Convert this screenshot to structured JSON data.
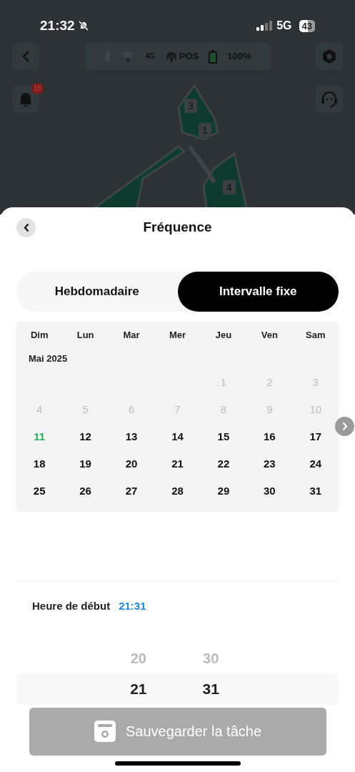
{
  "status_bar": {
    "time": "21:32",
    "network": "5G",
    "battery": "43"
  },
  "toolbar": {
    "network_label": "4G",
    "pos_label": "POS",
    "battery_level": "100%",
    "notification_count": "15"
  },
  "map": {
    "markers": [
      "3",
      "1",
      "4"
    ]
  },
  "sheet": {
    "title": "Fréquence",
    "tabs": [
      {
        "label": "Hebdomadaire",
        "selected": false
      },
      {
        "label": "Intervalle fixe",
        "selected": true
      }
    ],
    "calendar": {
      "weekdays": [
        "Dim",
        "Lun",
        "Mar",
        "Mer",
        "Jeu",
        "Ven",
        "Sam"
      ],
      "month": "Mai 2025",
      "weeks": [
        [
          {
            "kind": "blank"
          },
          {
            "kind": "blank"
          },
          {
            "kind": "blank"
          },
          {
            "kind": "blank"
          },
          {
            "kind": "past",
            "label": "1"
          },
          {
            "kind": "past",
            "label": "2"
          },
          {
            "kind": "past",
            "label": "3"
          }
        ],
        [
          {
            "kind": "past",
            "label": "4"
          },
          {
            "kind": "past",
            "label": "5"
          },
          {
            "kind": "past",
            "label": "6"
          },
          {
            "kind": "past",
            "label": "7"
          },
          {
            "kind": "past",
            "label": "8"
          },
          {
            "kind": "past",
            "label": "9"
          },
          {
            "kind": "past",
            "label": "10"
          }
        ],
        [
          {
            "kind": "today",
            "label": "11"
          },
          {
            "kind": "day",
            "label": "12"
          },
          {
            "kind": "day",
            "label": "13"
          },
          {
            "kind": "day",
            "label": "14"
          },
          {
            "kind": "day",
            "label": "15"
          },
          {
            "kind": "day",
            "label": "16"
          },
          {
            "kind": "day",
            "label": "17"
          }
        ],
        [
          {
            "kind": "day",
            "label": "18"
          },
          {
            "kind": "day",
            "label": "19"
          },
          {
            "kind": "day",
            "label": "20"
          },
          {
            "kind": "day",
            "label": "21"
          },
          {
            "kind": "day",
            "label": "22"
          },
          {
            "kind": "day",
            "label": "23"
          },
          {
            "kind": "day",
            "label": "24"
          }
        ],
        [
          {
            "kind": "day",
            "label": "25"
          },
          {
            "kind": "day",
            "label": "26"
          },
          {
            "kind": "day",
            "label": "27"
          },
          {
            "kind": "day",
            "label": "28"
          },
          {
            "kind": "day",
            "label": "29"
          },
          {
            "kind": "day",
            "label": "30"
          },
          {
            "kind": "day",
            "label": "31"
          }
        ]
      ]
    },
    "start_time": {
      "label": "Heure de début",
      "value": "21:31"
    },
    "picker": {
      "hours": [
        {
          "label": "20",
          "selected": false
        },
        {
          "label": "21",
          "selected": true
        }
      ],
      "minutes": [
        {
          "label": "30",
          "selected": false
        },
        {
          "label": "31",
          "selected": true
        }
      ]
    },
    "save_button": {
      "label": "Sauvegarder la tâche",
      "disabled": true
    }
  }
}
